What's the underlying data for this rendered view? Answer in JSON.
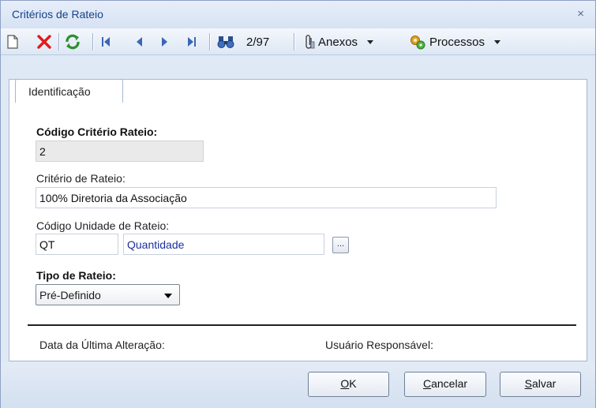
{
  "window": {
    "title": "Critérios de Rateio",
    "close_glyph": "×"
  },
  "toolbar": {
    "record_counter": "2/97",
    "attachments_label": "Anexos",
    "processes_label": "Processos",
    "icons": [
      "new-document-icon",
      "delete-icon",
      "refresh-icon",
      "first-record-icon",
      "previous-record-icon",
      "next-record-icon",
      "last-record-icon",
      "binoculars-icon",
      "paperclip-icon",
      "processes-gear-icon"
    ]
  },
  "tabs": [
    {
      "label": "Identificação",
      "active": true
    }
  ],
  "form": {
    "codigo_criterio": {
      "label": "Código Critério Rateio:",
      "value": "2"
    },
    "criterio": {
      "label": "Critério de Rateio:",
      "value": "100% Diretoria da Associação"
    },
    "unidade": {
      "label": "Código Unidade de Rateio:",
      "code": "QT",
      "description": "Quantidade",
      "lookup_label": "..."
    },
    "tipo": {
      "label": "Tipo de Rateio:",
      "selected": "Pré-Definido"
    },
    "data_alteracao_label": "Data da Última Alteração:",
    "usuario_label": "Usuário Responsável:"
  },
  "buttons": {
    "ok": {
      "first": "O",
      "rest": "K"
    },
    "cancel": {
      "first": "C",
      "rest": "ancelar"
    },
    "save": {
      "first": "S",
      "rest": "alvar"
    }
  },
  "colors": {
    "accent": "#15428b",
    "link": "#1d2f9e",
    "delete": "#e01b1b",
    "refresh": "#2f8f2f",
    "nav": "#3c66b5"
  }
}
